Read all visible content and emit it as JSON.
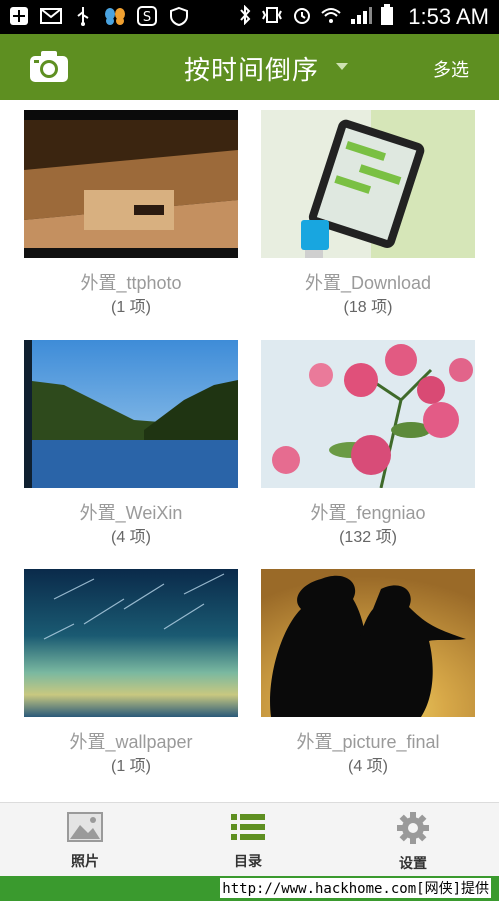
{
  "status_bar": {
    "time": "1:53 AM"
  },
  "action_bar": {
    "title": "按时间倒序",
    "multi_select": "多选"
  },
  "albums": [
    {
      "name": "外置_ttphoto",
      "count": "(1 项)"
    },
    {
      "name": "外置_Download",
      "count": "(18 项)"
    },
    {
      "name": "外置_WeiXin",
      "count": "(4 项)"
    },
    {
      "name": "外置_fengniao",
      "count": "(132 项)"
    },
    {
      "name": "外置_wallpaper",
      "count": "(1 项)"
    },
    {
      "name": "外置_picture_final",
      "count": "(4 项)"
    }
  ],
  "bottom_nav": [
    {
      "label": "照片",
      "icon": "photo-icon"
    },
    {
      "label": "目录",
      "icon": "list-icon"
    },
    {
      "label": "设置",
      "icon": "gear-icon"
    }
  ],
  "footer": {
    "text": "http://www.hackhome.com[网侠]提供"
  },
  "colors": {
    "action_bar": "#5e8f21",
    "accent_green": "#5e8f21",
    "footer": "#3a9a2e"
  }
}
